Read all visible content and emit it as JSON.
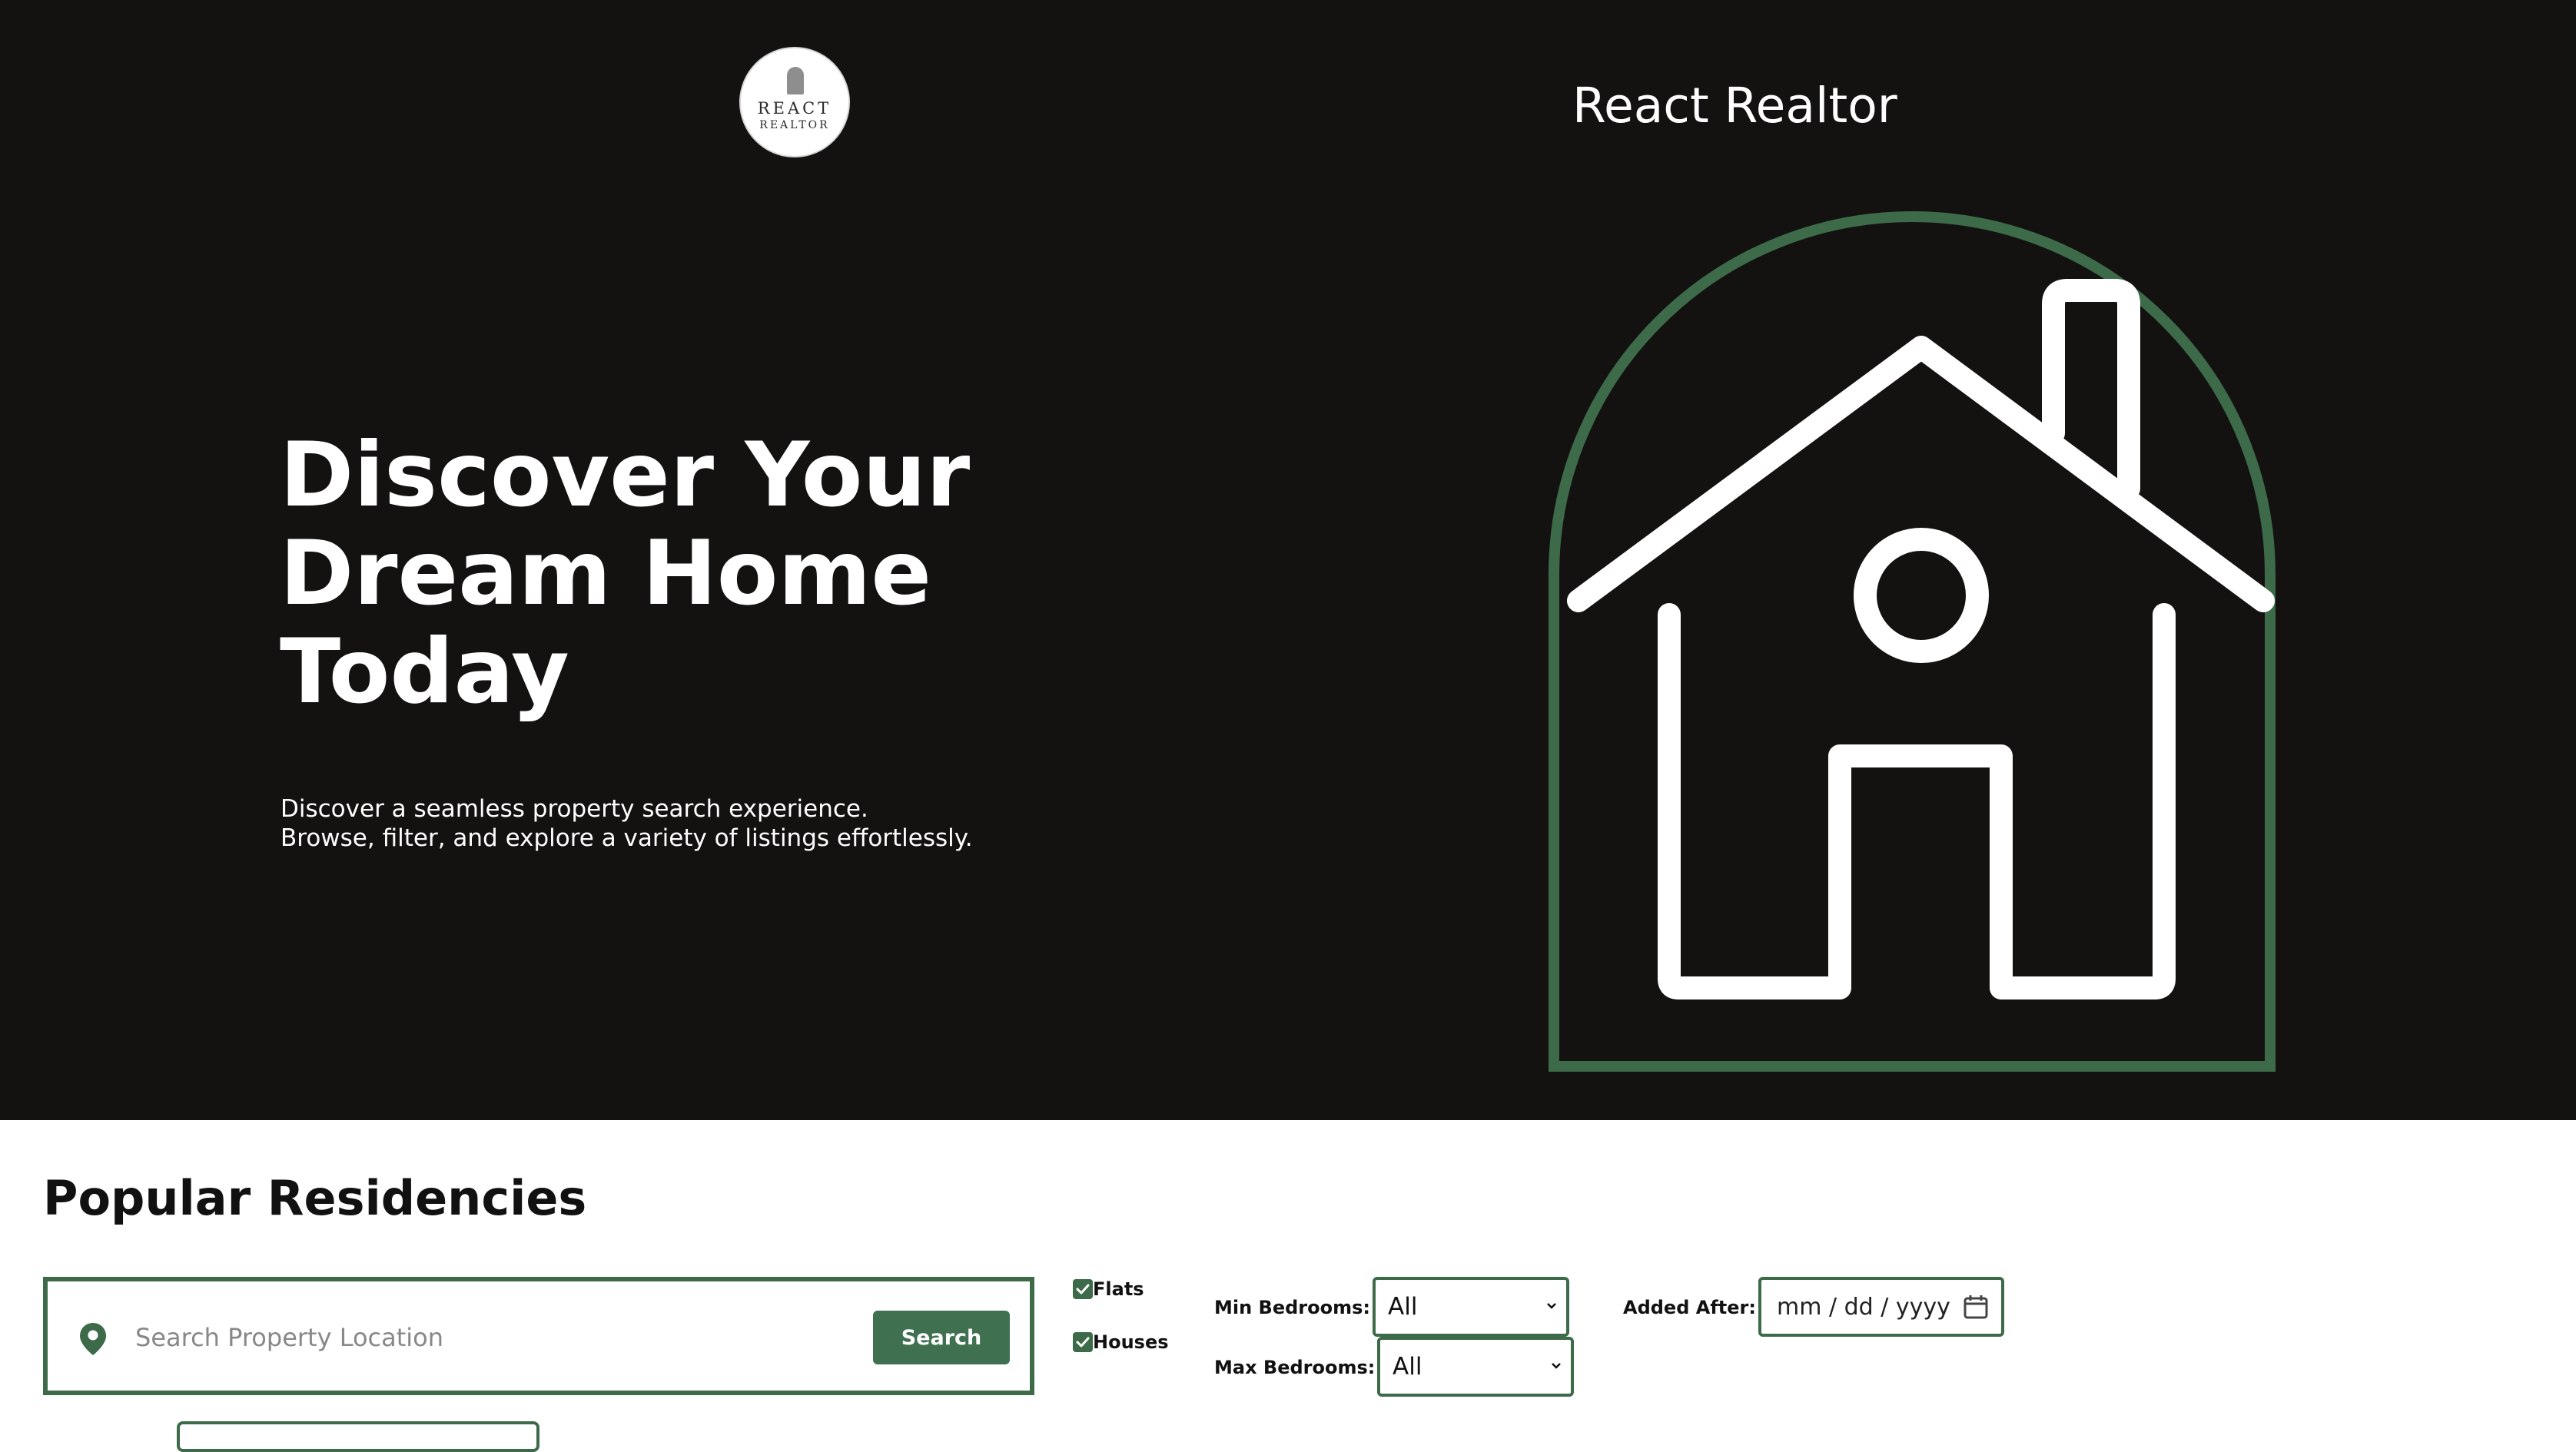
{
  "header": {
    "logo_line1": "REACT",
    "logo_line2": "REALTOR",
    "brand_name": "React Realtor"
  },
  "hero": {
    "headline": "Discover Your Dream Home Today",
    "subtext_line1": "Discover a seamless property search experience.",
    "subtext_line2": "Browse, filter, and explore a variety of listings effortlessly.",
    "illustration_icon": "house-arch-icon"
  },
  "listings": {
    "section_title": "Popular Residencies",
    "search": {
      "placeholder": "Search Property Location",
      "value": "",
      "button_label": "Search",
      "icon": "location-pin-icon"
    },
    "filters": {
      "flats_label": "Flats",
      "flats_checked": true,
      "houses_label": "Houses",
      "houses_checked": true,
      "min_bedrooms_label": "Min Bedrooms:",
      "min_bedrooms_value": "All",
      "max_bedrooms_label": "Max Bedrooms:",
      "max_bedrooms_value": "All",
      "added_after_label": "Added After:",
      "added_after_placeholder": "mm / dd / yyyy"
    }
  },
  "colors": {
    "hero_background": "#131211",
    "accent_green": "#3d6b4a",
    "button_green": "#3f7150",
    "text_dark": "#111111"
  }
}
